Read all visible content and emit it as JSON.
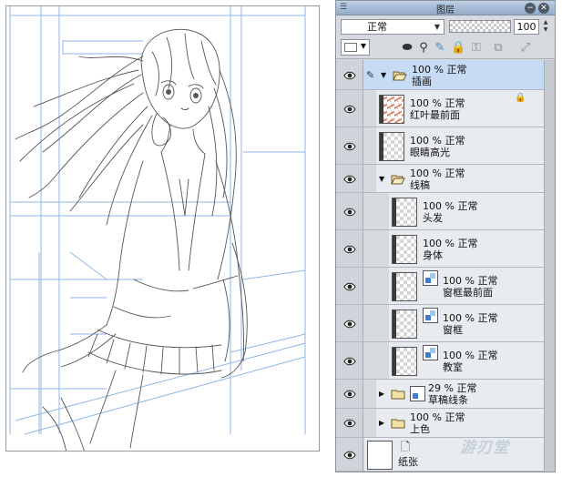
{
  "panel": {
    "title": "图层",
    "blend_mode": "正常",
    "opacity_value": "100",
    "toolbar_icons": [
      "lock-transparent-icon",
      "paper-icon",
      "ruler-icon",
      "lock-icon",
      "clip-icon",
      "reference-icon",
      "mask-icon"
    ]
  },
  "layers": [
    {
      "opacity_mode": "100 % 正常",
      "name": "插画",
      "type": "folder",
      "expanded": true,
      "selected": true
    },
    {
      "opacity_mode": "100 % 正常",
      "name": "红叶最前面",
      "type": "raster",
      "thumb": "red",
      "locked": true
    },
    {
      "opacity_mode": "100 % 正常",
      "name": "眼睛高光",
      "type": "raster",
      "thumb": "dark-left"
    },
    {
      "opacity_mode": "100 % 正常",
      "name": "线稿",
      "type": "folder",
      "expanded": true
    },
    {
      "opacity_mode": "100 % 正常",
      "name": "头发",
      "type": "raster",
      "thumb": "dark-left"
    },
    {
      "opacity_mode": "100 % 正常",
      "name": "身体",
      "type": "raster",
      "thumb": "dark-left"
    },
    {
      "opacity_mode": "100 % 正常",
      "name": "窗框最前面",
      "type": "vector",
      "thumb": "dark-left"
    },
    {
      "opacity_mode": "100 % 正常",
      "name": "窗框",
      "type": "vector",
      "thumb": "dark-left"
    },
    {
      "opacity_mode": "100 % 正常",
      "name": "教室",
      "type": "vector",
      "thumb": "dark-left"
    },
    {
      "opacity_mode": "29 % 正常",
      "name": "草稿线条",
      "type": "folder",
      "expanded": false,
      "vector": true
    },
    {
      "opacity_mode": "100 % 正常",
      "name": "上色",
      "type": "folder",
      "expanded": false
    },
    {
      "opacity_mode": "",
      "name": "纸张",
      "type": "paper",
      "thumb": "plain"
    }
  ],
  "colors": {
    "panel_bg": "#d6d9de",
    "selected_row": "#c5dcf4",
    "guide_line": "#8fb6e6",
    "sketch_line": "#555555"
  },
  "watermark": "游刃堂"
}
